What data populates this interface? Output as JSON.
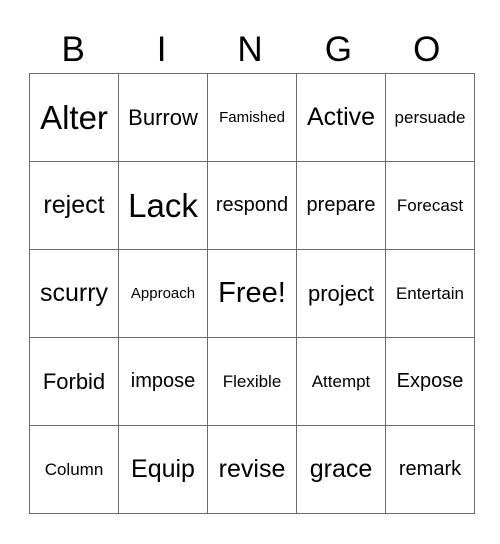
{
  "header": [
    "B",
    "I",
    "N",
    "G",
    "O"
  ],
  "rows": [
    [
      "Alter",
      "Burrow",
      "Famished",
      "Active",
      "persuade"
    ],
    [
      "reject",
      "Lack",
      "respond",
      "prepare",
      "Forecast"
    ],
    [
      "scurry",
      "Approach",
      "Free!",
      "project",
      "Entertain"
    ],
    [
      "Forbid",
      "impose",
      "Flexible",
      "Attempt",
      "Expose"
    ],
    [
      "Column",
      "Equip",
      "revise",
      "grace",
      "remark"
    ]
  ]
}
